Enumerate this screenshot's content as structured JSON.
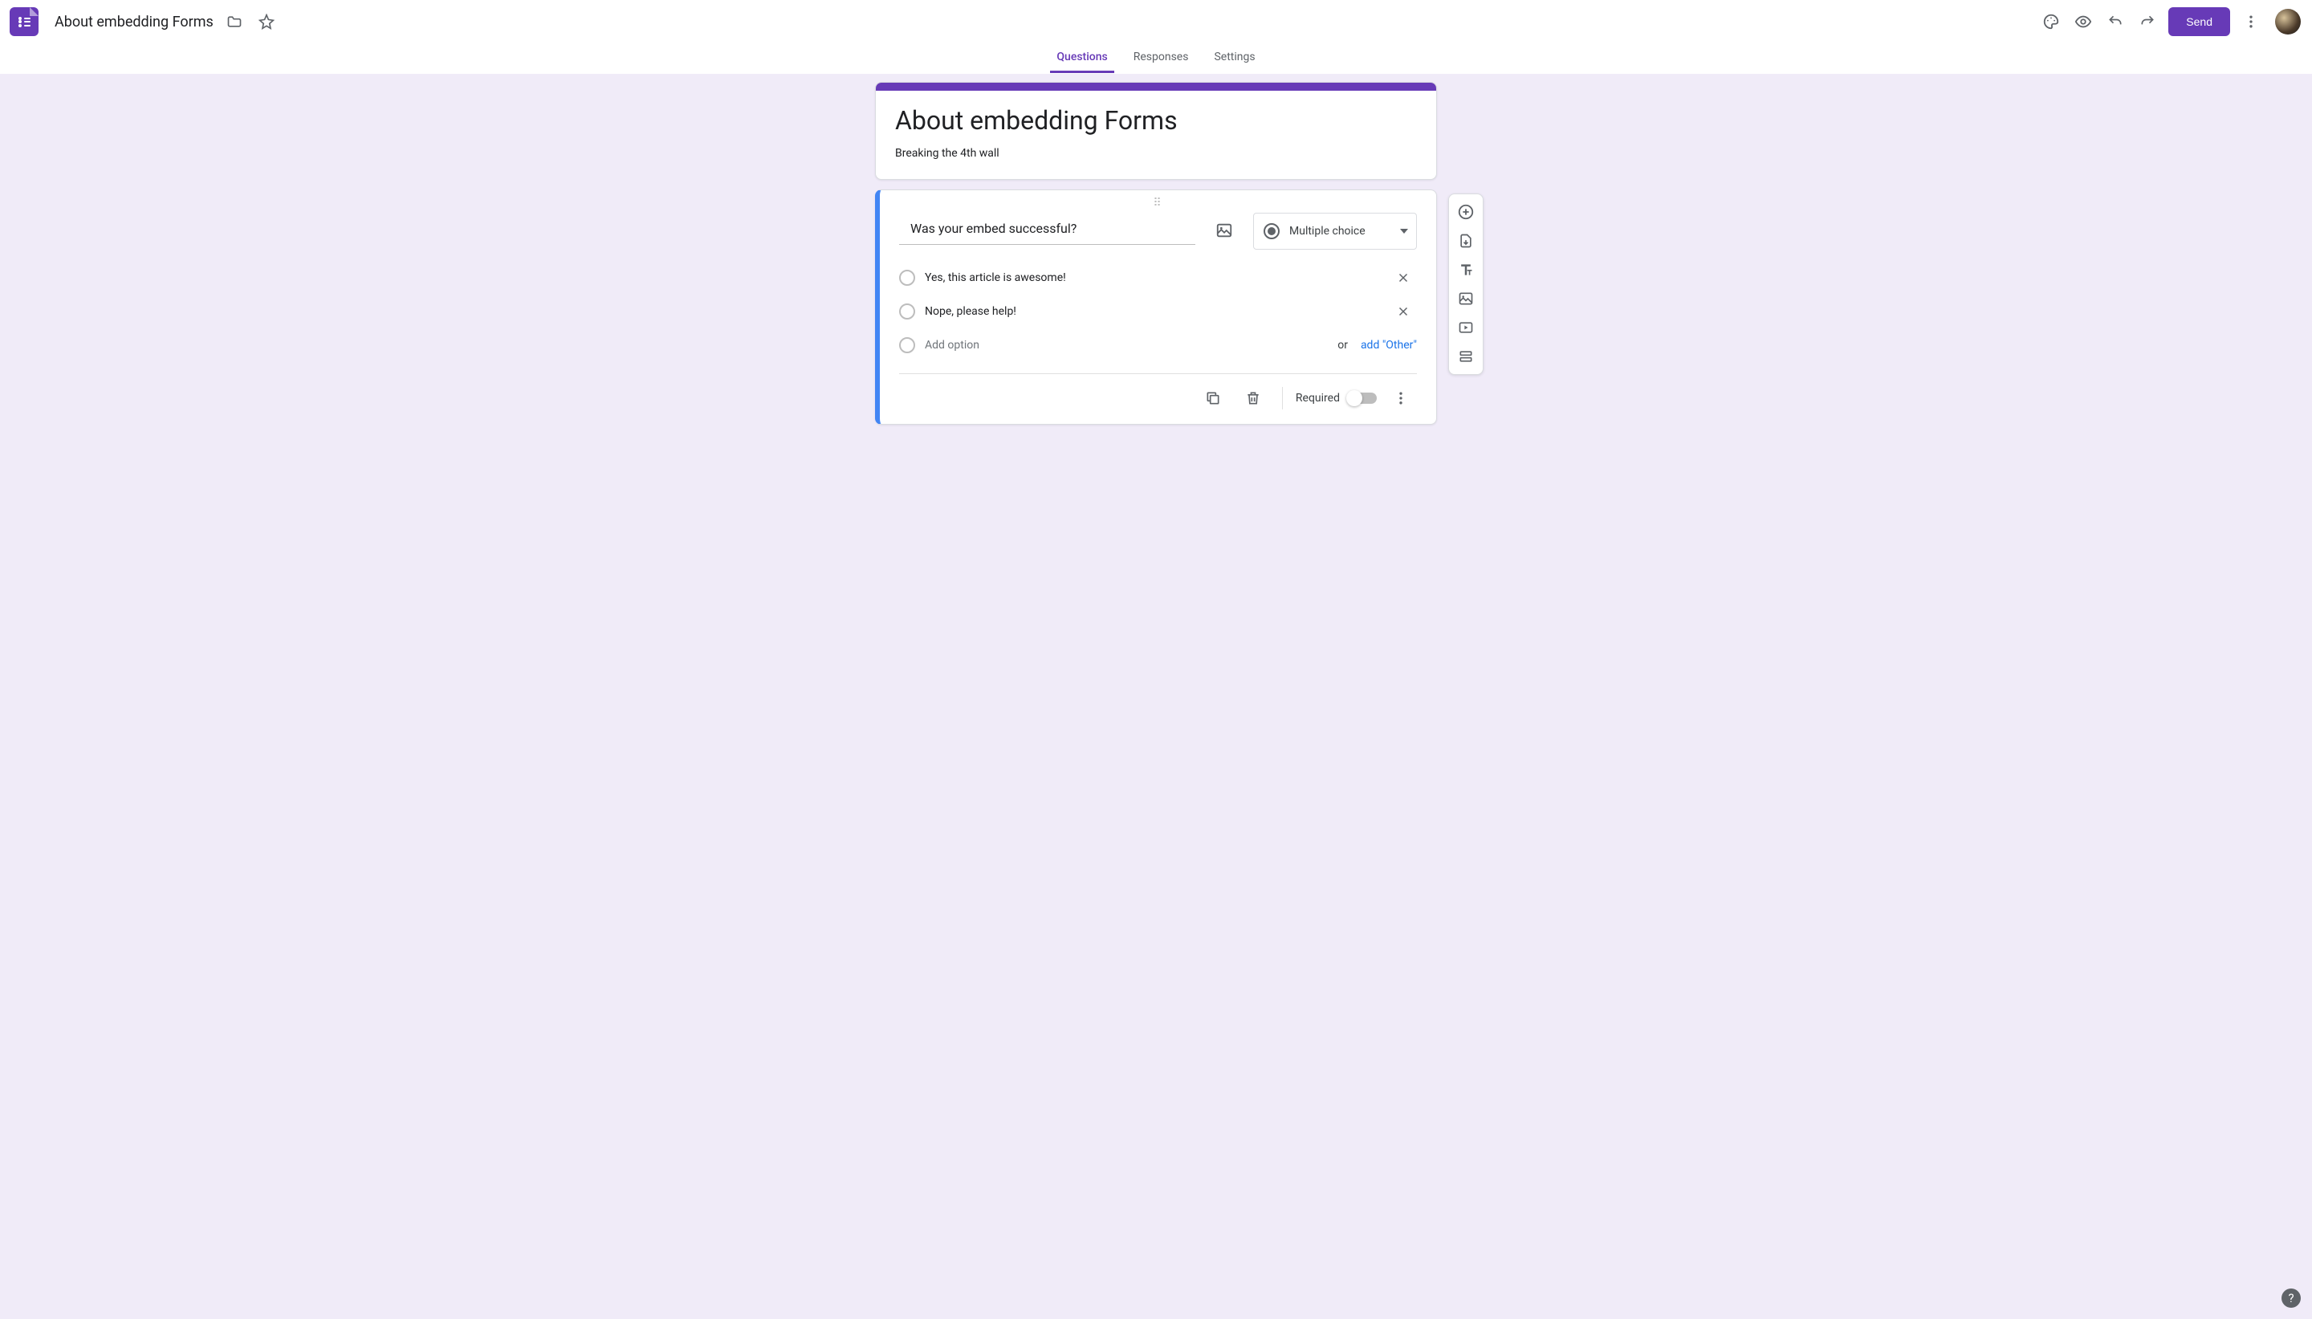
{
  "header": {
    "doc_title": "About embedding Forms",
    "send_label": "Send"
  },
  "tabs": {
    "questions": "Questions",
    "responses": "Responses",
    "settings": "Settings"
  },
  "form": {
    "title": "About embedding Forms",
    "description": "Breaking the 4th wall"
  },
  "question": {
    "title": "Was your embed successful?",
    "type_label": "Multiple choice",
    "options": [
      "Yes, this article is awesome!",
      "Nope, please help!"
    ],
    "add_option_placeholder": "Add option",
    "or_text": "or",
    "add_other_label": "add \"Other\"",
    "required_label": "Required"
  },
  "icons": {
    "folder": "folder",
    "star": "star",
    "palette": "palette",
    "preview": "preview",
    "undo": "undo",
    "redo": "redo",
    "more": "more",
    "avatar": "avatar",
    "add_question": "add-question",
    "import_questions": "import-questions",
    "add_title": "add-title",
    "add_image": "add-image",
    "add_video": "add-video",
    "add_section": "add-section",
    "help": "?"
  }
}
